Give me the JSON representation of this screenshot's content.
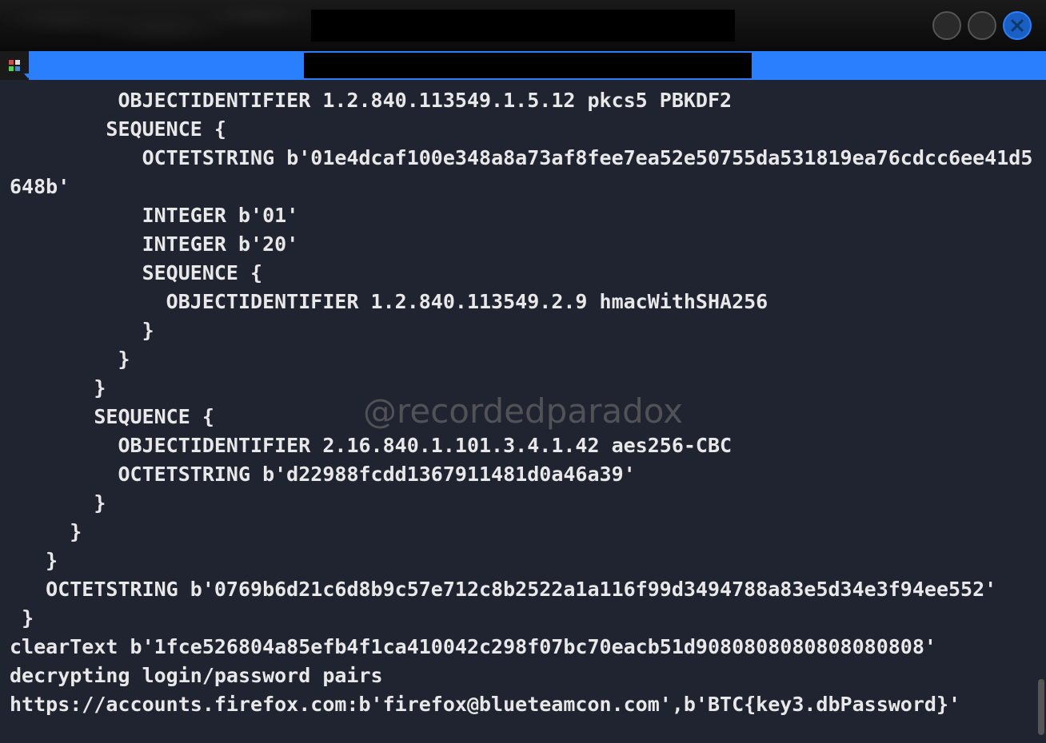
{
  "window": {
    "title_redacted": true
  },
  "watermark": "@recordedparadox",
  "terminal": {
    "lines": [
      "         OBJECTIDENTIFIER 1.2.840.113549.1.5.12 pkcs5 PBKDF2",
      "        SEQUENCE {",
      "           OCTETSTRING b'01e4dcaf100e348a8a73af8fee7ea52e50755da531819ea76cdcc6ee41d5648b'",
      "           INTEGER b'01'",
      "           INTEGER b'20'",
      "           SEQUENCE {",
      "             OBJECTIDENTIFIER 1.2.840.113549.2.9 hmacWithSHA256",
      "           }",
      "         }",
      "       }",
      "       SEQUENCE {",
      "         OBJECTIDENTIFIER 2.16.840.1.101.3.4.1.42 aes256-CBC",
      "         OCTETSTRING b'd22988fcdd1367911481d0a46a39'",
      "       }",
      "     }",
      "   }",
      "   OCTETSTRING b'0769b6d21c6d8b9c57e712c8b2522a1a116f99d3494788a83e5d34e3f94ee552'",
      " }",
      "clearText b'1fce526804a85efb4f1ca410042c298f07bc70eacb51d9080808080808080808'",
      "decrypting login/password pairs",
      "https://accounts.firefox.com:b'firefox@blueteamcon.com',b'BTC{key3.dbPassword}'"
    ]
  }
}
